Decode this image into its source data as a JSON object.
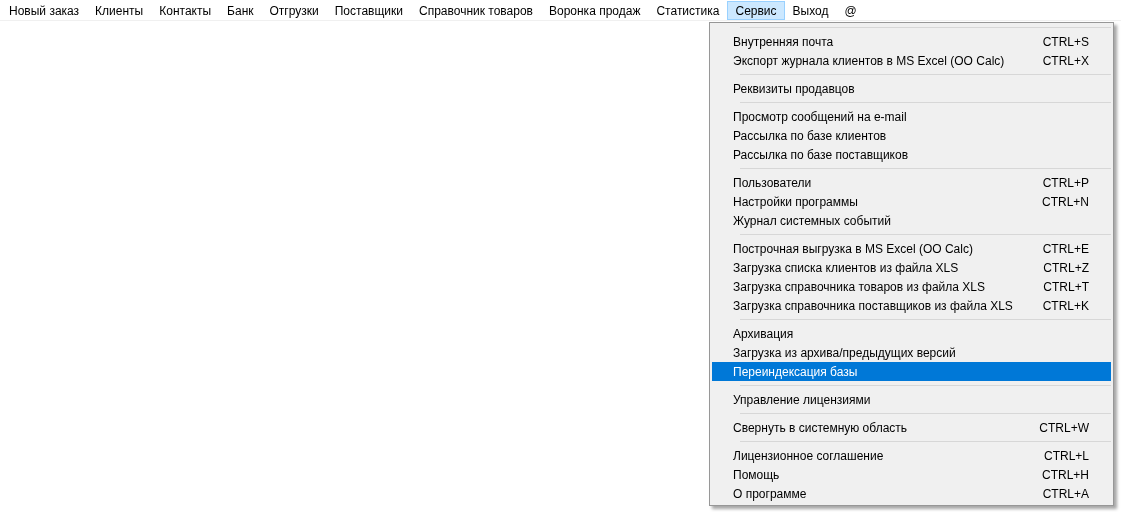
{
  "menu_bar": {
    "items": [
      {
        "label": "Новый заказ",
        "selected": false
      },
      {
        "label": "Клиенты",
        "selected": false
      },
      {
        "label": "Контакты",
        "selected": false
      },
      {
        "label": "Банк",
        "selected": false
      },
      {
        "label": "Отгрузки",
        "selected": false
      },
      {
        "label": "Поставщики",
        "selected": false
      },
      {
        "label": "Справочник товаров",
        "selected": false
      },
      {
        "label": "Воронка продаж",
        "selected": false
      },
      {
        "label": "Статистика",
        "selected": false
      },
      {
        "label": "Сервис",
        "selected": true
      },
      {
        "label": "Выход",
        "selected": false
      },
      {
        "label": "@",
        "selected": false
      }
    ]
  },
  "dropdown_menu": {
    "groups": [
      [
        {
          "label": "Внутренняя почта",
          "shortcut": "CTRL+S",
          "selected": false
        },
        {
          "label": "Экспорт журнала клиентов в MS Excel (OO Calc)",
          "shortcut": "CTRL+X",
          "selected": false
        }
      ],
      [
        {
          "label": "Реквизиты продавцов",
          "selected": false
        }
      ],
      [
        {
          "label": "Просмотр сообщений на e-mail",
          "selected": false
        },
        {
          "label": "Рассылка по базе клиентов",
          "selected": false
        },
        {
          "label": "Рассылка по базе поставщиков",
          "selected": false
        }
      ],
      [
        {
          "label": "Пользователи",
          "shortcut": "CTRL+P",
          "selected": false
        },
        {
          "label": "Настройки программы",
          "shortcut": "CTRL+N",
          "selected": false
        },
        {
          "label": "Журнал системных событий",
          "selected": false
        }
      ],
      [
        {
          "label": "Построчная выгрузка в MS Excel (OO Calc)",
          "shortcut": "CTRL+E",
          "selected": false
        },
        {
          "label": "Загрузка списка клиентов из файла XLS",
          "shortcut": "CTRL+Z",
          "selected": false
        },
        {
          "label": "Загрузка справочника товаров из файла XLS",
          "shortcut": "CTRL+T",
          "selected": false
        },
        {
          "label": "Загрузка справочника поставщиков из файла XLS",
          "shortcut": "CTRL+K",
          "selected": false
        }
      ],
      [
        {
          "label": "Архивация",
          "selected": false
        },
        {
          "label": "Загрузка из архива/предыдущих версий",
          "selected": false
        },
        {
          "label": "Переиндексация базы",
          "selected": true
        }
      ],
      [
        {
          "label": "Управление лицензиями",
          "selected": false
        }
      ],
      [
        {
          "label": "Свернуть в системную область",
          "shortcut": "CTRL+W",
          "selected": false
        }
      ],
      [
        {
          "label": "Лицензионное соглашение",
          "shortcut": "CTRL+L",
          "selected": false
        },
        {
          "label": "Помощь",
          "shortcut": "CTRL+H",
          "selected": false
        },
        {
          "label": "О программе",
          "shortcut": "CTRL+A",
          "selected": false
        }
      ]
    ]
  }
}
